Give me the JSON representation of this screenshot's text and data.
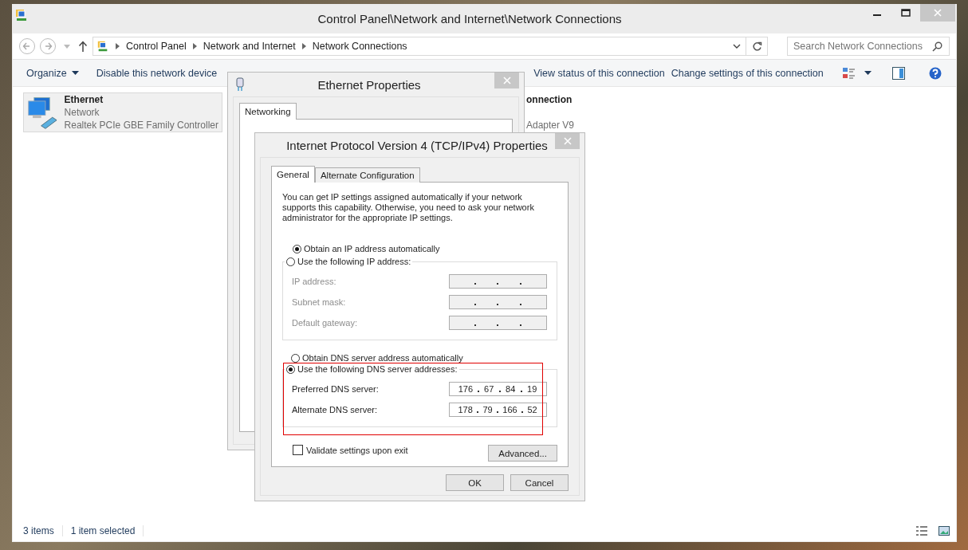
{
  "window": {
    "title": "Control Panel\\Network and Internet\\Network Connections"
  },
  "address_bar": {
    "crumbs": [
      "Control Panel",
      "Network and Internet",
      "Network Connections"
    ]
  },
  "search": {
    "placeholder": "Search Network Connections"
  },
  "toolbar": {
    "organize": "Organize",
    "actions": [
      "Disable this network device",
      "View status of this connection",
      "Change settings of this connection"
    ]
  },
  "connections": [
    {
      "name": "Ethernet",
      "status": "Network",
      "device": "Realtek PCIe GBE Family Controller",
      "selected": true
    },
    {
      "name": "onnection",
      "device": "Adapter V9",
      "selected": false
    }
  ],
  "status_bar": {
    "count": "3 items",
    "selection": "1 item selected"
  },
  "ethernet_dialog": {
    "title": "Ethernet Properties",
    "tabs": [
      {
        "label": "Networking",
        "selected": true
      }
    ]
  },
  "ipv4_dialog": {
    "title": "Internet Protocol Version 4 (TCP/IPv4) Properties",
    "tabs": [
      {
        "label": "General",
        "selected": true
      },
      {
        "label": "Alternate Configuration",
        "selected": false
      }
    ],
    "intro": "You can get IP settings assigned automatically if your network supports this capability. Otherwise, you need to ask your network administrator for the appropriate IP settings.",
    "ip_options": [
      {
        "label": "Obtain an IP address automatically",
        "selected": true
      },
      {
        "label": "Use the following IP address:",
        "selected": false
      }
    ],
    "ip_fields": [
      {
        "label": "IP address:",
        "disabled": true
      },
      {
        "label": "Subnet mask:",
        "disabled": true
      },
      {
        "label": "Default gateway:",
        "disabled": true
      }
    ],
    "dns_options": [
      {
        "label": "Obtain DNS server address automatically",
        "selected": false
      },
      {
        "label": "Use the following DNS server addresses:",
        "selected": true
      }
    ],
    "dns_fields": [
      {
        "label": "Preferred DNS server:",
        "octets": [
          "176",
          "67",
          "84",
          "19"
        ],
        "disabled": false
      },
      {
        "label": "Alternate DNS server:",
        "octets": [
          "178",
          "79",
          "166",
          "52"
        ],
        "disabled": false
      }
    ],
    "validate": {
      "label": "Validate settings upon exit",
      "checked": false
    },
    "advanced_button": "Advanced...",
    "buttons": [
      "OK",
      "Cancel"
    ]
  }
}
